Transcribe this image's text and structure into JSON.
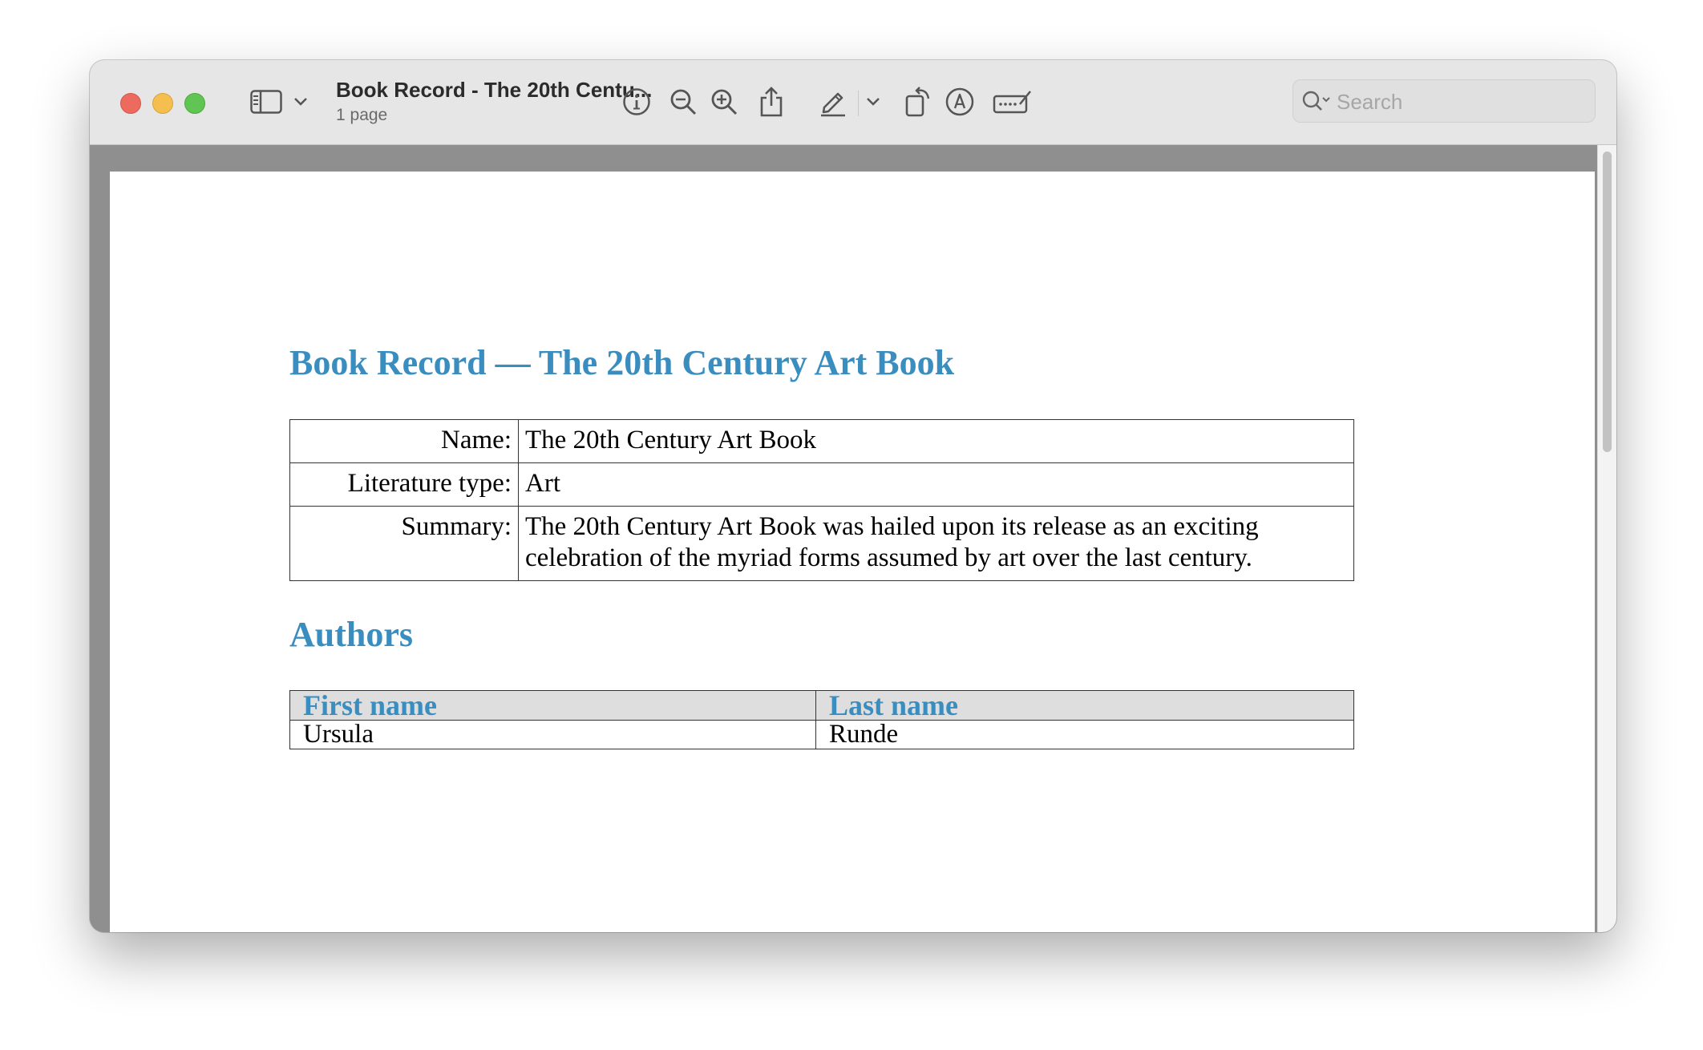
{
  "window": {
    "title": "Book Record - The 20th Centu...",
    "subtitle": "1 page"
  },
  "toolbar": {
    "icons": [
      "sidebar-icon",
      "chevron-down-icon",
      "info-icon",
      "zoom-out-icon",
      "zoom-in-icon",
      "share-icon",
      "markup-pen-icon",
      "chevron-down-icon",
      "rotate-icon",
      "markup-icon",
      "signature-icon",
      "search-icon"
    ],
    "search_placeholder": "Search"
  },
  "document": {
    "heading": "Book Record — The 20th Century Art Book",
    "info_rows": [
      {
        "label": "Name:",
        "value": "The 20th Century Art Book"
      },
      {
        "label": "Literature type:",
        "value": "Art"
      },
      {
        "label": "Summary:",
        "value": "The 20th Century Art Book was hailed upon its release as an exciting celebration of the myriad forms assumed by art over the last century."
      }
    ],
    "authors_heading": "Authors",
    "authors_columns": [
      "First name",
      "Last name"
    ],
    "authors": [
      {
        "first": "Ursula",
        "last": "Runde"
      }
    ]
  },
  "colors": {
    "accent": "#3a8dbf",
    "close": "#ed6a5e",
    "minimize": "#f4bf4f",
    "maximize": "#61c554"
  }
}
